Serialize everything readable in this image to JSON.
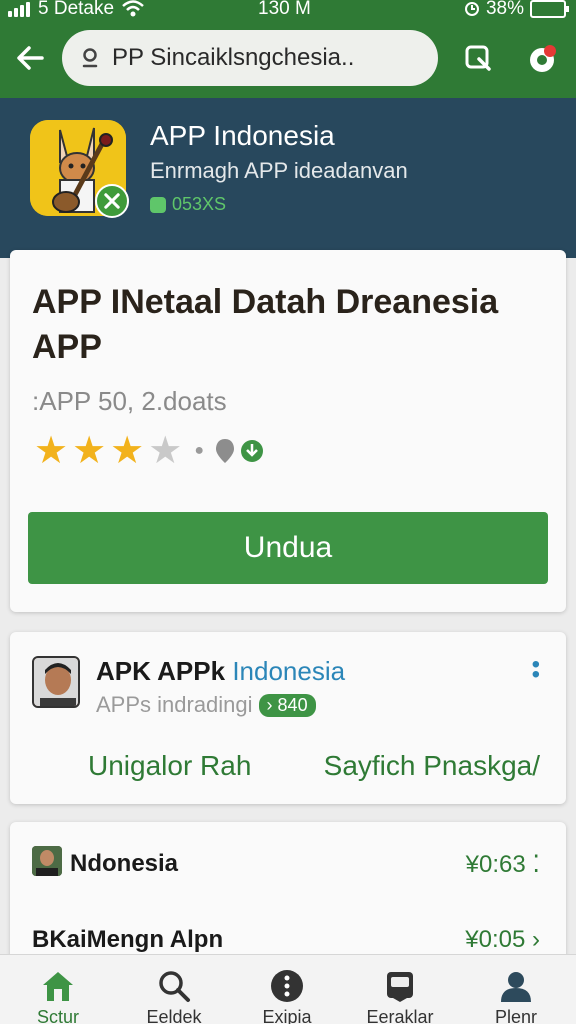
{
  "status_bar": {
    "carrier": "5 Detake",
    "time": "130 M",
    "battery": "38%"
  },
  "header": {
    "search_value": "PP Sincaiklsngchesia..",
    "icons": [
      "back-arrow-icon",
      "search-icon",
      "cast-icon",
      "notification-icon"
    ],
    "colors": {
      "header_bg": "#2f7a35",
      "banner_bg": "#28485d",
      "accent": "#3e9445"
    }
  },
  "app_banner": {
    "title": "APP Indonesia",
    "subtitle": "Enrmagh APP ideadanvan",
    "meta": "053XS"
  },
  "app_detail": {
    "title": "APP INetaal Datah Dreanesia APP",
    "downloads": ":APP 50, 2.doats",
    "rating": 3,
    "rating_max": 5,
    "install_label": "Undua"
  },
  "developer": {
    "name": "APK APPk",
    "name_highlight": "Indonesia",
    "subtitle": "APPs indradingi",
    "badge": "840",
    "link_left": "Unigalor Rah",
    "link_right": "Sayfich Pnaskga/"
  },
  "list": {
    "rows": [
      {
        "title": "Ndonesia",
        "price": "¥0:63"
      },
      {
        "title": "BKaiMengn Alpn",
        "price": "¥0:05"
      }
    ]
  },
  "bottom_nav": {
    "items": [
      {
        "label": "Sctur",
        "icon": "home-icon",
        "active": true
      },
      {
        "label": "Eeldek",
        "icon": "search-icon",
        "active": false
      },
      {
        "label": "Exipia",
        "icon": "more-icon",
        "active": false
      },
      {
        "label": "Eeraklar",
        "icon": "library-icon",
        "active": false
      },
      {
        "label": "Plenr",
        "icon": "profile-icon",
        "active": false
      }
    ]
  }
}
